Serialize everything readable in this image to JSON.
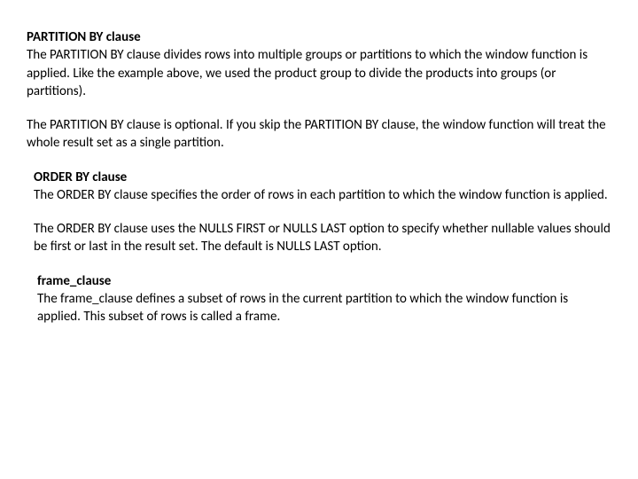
{
  "sections": [
    {
      "heading": "PARTITION BY clause",
      "paragraphs": [
        "The PARTITION BY clause divides rows into multiple groups or partitions to which the window function is applied. Like the example above, we used the product group to divide the products into groups (or partitions).",
        "The PARTITION BY clause is optional. If you skip the PARTITION BY clause, the window function will treat the whole result set as a single partition."
      ]
    },
    {
      "heading": "ORDER BY clause",
      "paragraphs": [
        "The ORDER BY clause specifies the order of rows in each partition to which the window function is applied.",
        "The ORDER BY clause uses the NULLS FIRST or NULLS LAST option to specify whether nullable values should be first or last in the result set. The default is NULLS LAST option."
      ]
    },
    {
      "heading": "frame_clause",
      "paragraphs": [
        "The frame_clause defines a subset of rows in the current partition to which the window function is applied. This subset of rows is called a frame."
      ]
    }
  ]
}
